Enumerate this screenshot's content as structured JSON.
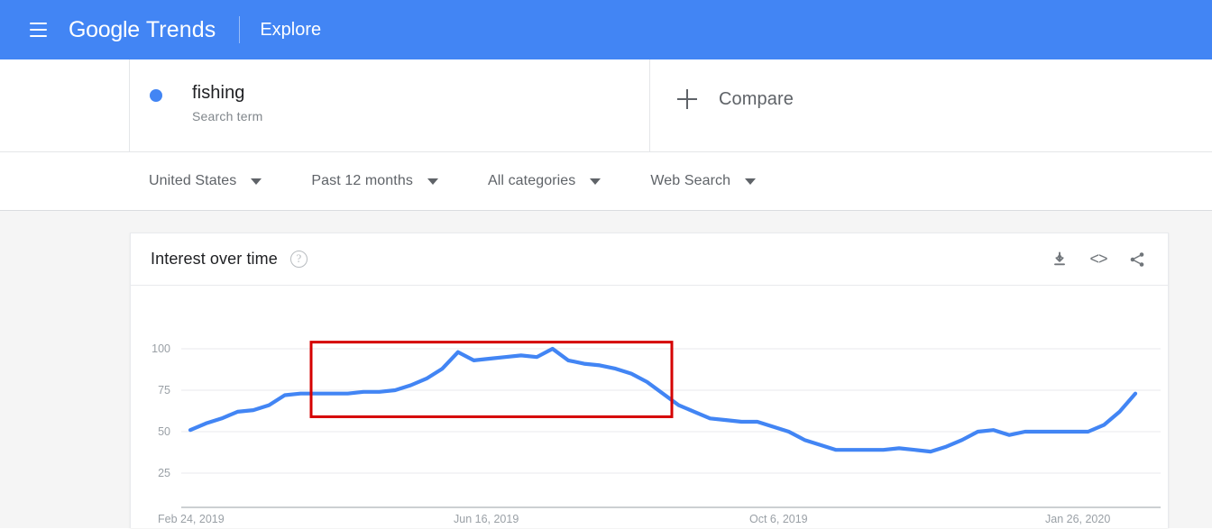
{
  "appbar": {
    "menu_icon": "hamburger-menu-icon",
    "brand_google": "Google",
    "brand_trends": "Trends",
    "explore_label": "Explore"
  },
  "search_terms": {
    "term": {
      "name": "fishing",
      "subtitle": "Search term",
      "dot_color": "#4285f4"
    },
    "compare": {
      "label": "Compare",
      "icon": "plus-icon"
    }
  },
  "filters": [
    {
      "label": "United States"
    },
    {
      "label": "Past 12 months"
    },
    {
      "label": "All categories"
    },
    {
      "label": "Web Search"
    }
  ],
  "chart_card": {
    "title": "Interest over time",
    "help_icon": "help-circle-icon",
    "actions": [
      {
        "name": "download-icon",
        "title": "Download"
      },
      {
        "name": "embed-icon",
        "glyph": "<>",
        "title": "Embed"
      },
      {
        "name": "share-icon",
        "title": "Share"
      }
    ]
  },
  "chart_data": {
    "type": "line",
    "title": "Interest over time",
    "xlabel": "",
    "ylabel": "",
    "ylim": [
      0,
      105
    ],
    "yticks": [
      25,
      50,
      75,
      100
    ],
    "ytick_labels": [
      "25",
      "50",
      "75",
      "100"
    ],
    "grid": true,
    "legend": false,
    "line_color": "#4285f4",
    "series": [
      {
        "name": "fishing",
        "values": [
          51,
          55,
          58,
          62,
          63,
          66,
          72,
          73,
          73,
          73,
          73,
          74,
          74,
          75,
          78,
          82,
          88,
          98,
          93,
          94,
          95,
          96,
          95,
          100,
          93,
          91,
          90,
          88,
          85,
          80,
          73,
          66,
          62,
          58,
          57,
          56,
          56,
          53,
          50,
          45,
          42,
          39,
          39,
          39,
          39,
          40,
          39,
          38,
          41,
          45,
          50,
          51,
          48,
          50,
          50,
          50,
          50,
          50,
          54,
          62,
          73
        ]
      }
    ],
    "xticks": [
      "Feb 24, 2019",
      "Jun 16, 2019",
      "Oct 6, 2019",
      "Jan 26, 2020"
    ],
    "annotation": {
      "type": "rectangle",
      "color": "#d50000",
      "x_start_label": "Apr 2019",
      "x_end_label": "Sep 2019",
      "y_top": 104,
      "y_bottom": 59
    }
  }
}
